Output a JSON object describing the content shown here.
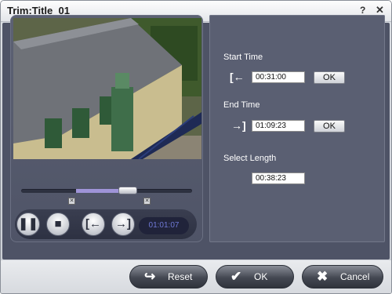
{
  "window": {
    "title": "Trim:Title_01",
    "help_glyph": "?",
    "close_glyph": "✕"
  },
  "player": {
    "current_time": "01:01:07",
    "buttons": [
      "pause",
      "stop",
      "set-start",
      "set-end"
    ]
  },
  "trim": {
    "start_label": "Start Time",
    "start_value": "00:31:00",
    "end_label": "End Time",
    "end_value": "01:09:23",
    "length_label": "Select Length",
    "length_value": "00:38:23",
    "ok_label": "OK"
  },
  "footer": {
    "reset_label": "Reset",
    "ok_label": "OK",
    "cancel_label": "Cancel"
  },
  "colors": {
    "panel": "#4e5366",
    "accent": "#9f94d8",
    "time_text": "#6f79d6"
  }
}
